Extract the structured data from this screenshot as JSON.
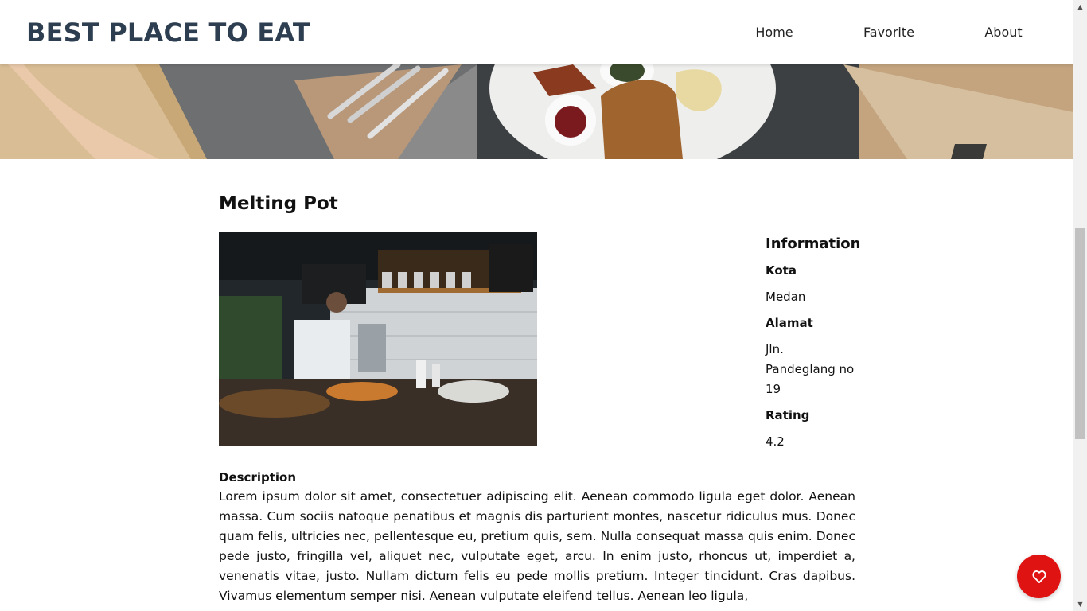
{
  "header": {
    "brand": "BEST PLACE TO EAT",
    "nav": [
      {
        "label": "Home"
      },
      {
        "label": "Favorite"
      },
      {
        "label": "About"
      }
    ]
  },
  "restaurant": {
    "name": "Melting Pot",
    "info": {
      "heading": "Information",
      "city_label": "Kota",
      "city_value": "Medan",
      "address_label": "Alamat",
      "address_value": "Jln. Pandeglang no 19",
      "rating_label": "Rating",
      "rating_value": "4.2"
    },
    "description": {
      "label": "Description",
      "text": "Lorem ipsum dolor sit amet, consectetuer adipiscing elit. Aenean commodo ligula eget dolor. Aenean massa. Cum sociis natoque penatibus et magnis dis parturient montes, nascetur ridiculus mus. Donec quam felis, ultricies nec, pellentesque eu, pretium quis, sem. Nulla consequat massa quis enim. Donec pede justo, fringilla vel, aliquet nec, vulputate eget, arcu. In enim justo, rhoncus ut, imperdiet a, venenatis vitae, justo. Nullam dictum felis eu pede mollis pretium. Integer tincidunt. Cras dapibus. Vivamus elementum semper nisi. Aenean vulputate eleifend tellus. Aenean leo ligula,"
    }
  },
  "icons": {
    "favorite": "heart-icon",
    "scroll_up": "scroll-up-arrow-icon",
    "scroll_down": "scroll-down-arrow-icon"
  },
  "colors": {
    "brand": "#2d3e50",
    "favorite_button": "#e01313"
  }
}
